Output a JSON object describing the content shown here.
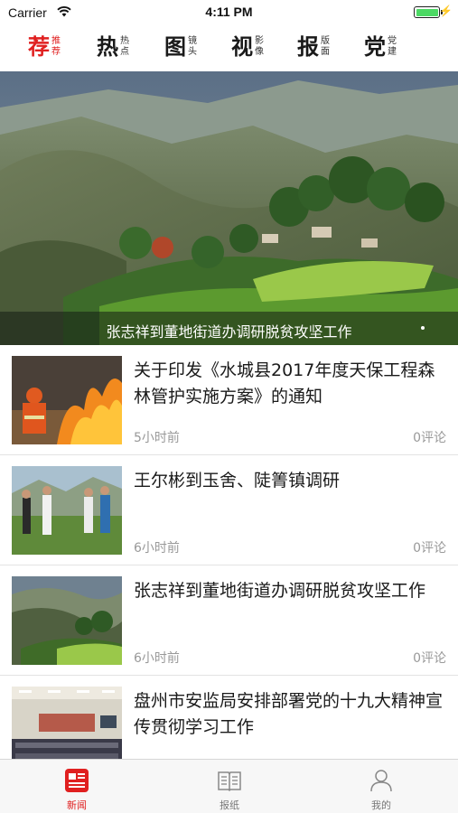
{
  "status_bar": {
    "carrier": "Carrier",
    "time": "4:11 PM",
    "battery_level": 1.0
  },
  "top_tabs": [
    {
      "big": "荐",
      "small_1": "推",
      "small_2": "荐",
      "active": true
    },
    {
      "big": "热",
      "small_1": "热",
      "small_2": "点",
      "active": false
    },
    {
      "big": "图",
      "small_1": "镜",
      "small_2": "头",
      "active": false
    },
    {
      "big": "视",
      "small_1": "影",
      "small_2": "像",
      "active": false
    },
    {
      "big": "报",
      "small_1": "版",
      "small_2": "面",
      "active": false
    },
    {
      "big": "党",
      "small_1": "党",
      "small_2": "建",
      "active": false
    }
  ],
  "hero": {
    "caption": "张志祥到董地街道办调研脱贫攻坚工作"
  },
  "news": [
    {
      "title": "关于印发《水城县2017年度天保工程森林管护实施方案》的通知",
      "time": "5小时前",
      "comments": "0评论",
      "thumb": "forest-fire-firefighter"
    },
    {
      "title": "王尔彬到玉舍、陡箐镇调研",
      "time": "6小时前",
      "comments": "0评论",
      "thumb": "officials-in-field"
    },
    {
      "title": "张志祥到董地街道办调研脱贫攻坚工作",
      "time": "6小时前",
      "comments": "0评论",
      "thumb": "mountain-village"
    },
    {
      "title": "盘州市安监局安排部署党的十九大精神宣传贯彻学习工作",
      "time": "",
      "comments": "",
      "thumb": "meeting-room"
    }
  ],
  "bottom_tabs": [
    {
      "label": "新闻",
      "icon": "news-icon",
      "active": true
    },
    {
      "label": "报纸",
      "icon": "newspaper-icon",
      "active": false
    },
    {
      "label": "我的",
      "icon": "profile-icon",
      "active": false
    }
  ],
  "colors": {
    "accent": "#e02020",
    "muted_text": "#999999",
    "battery": "#4cd964"
  }
}
